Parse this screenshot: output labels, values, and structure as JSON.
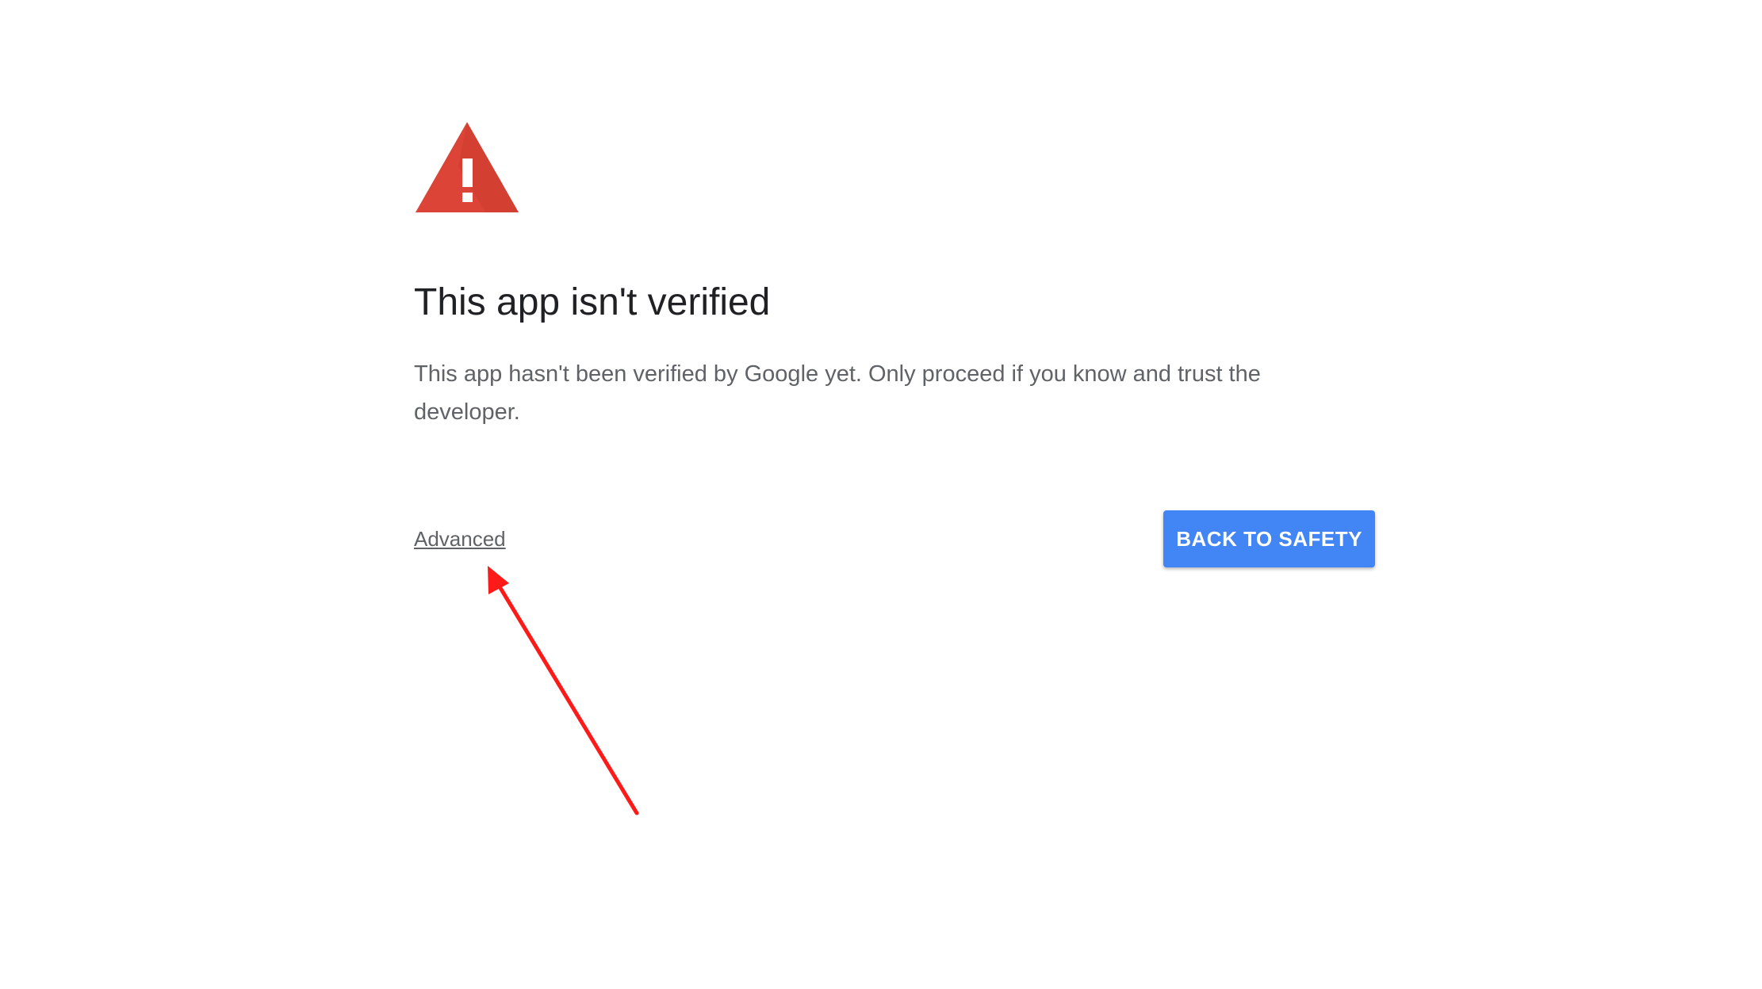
{
  "warning": {
    "icon": "warning-triangle-icon",
    "color": "#db4437"
  },
  "title": "This app isn't verified",
  "message": "This app hasn't been verified by Google yet. Only proceed if you know and trust the developer.",
  "advanced_link": "Advanced",
  "back_button": {
    "label": "BACK TO SAFETY",
    "color": "#4285f4"
  },
  "annotation": {
    "icon": "red-arrow-icon",
    "color": "#ff0000"
  }
}
